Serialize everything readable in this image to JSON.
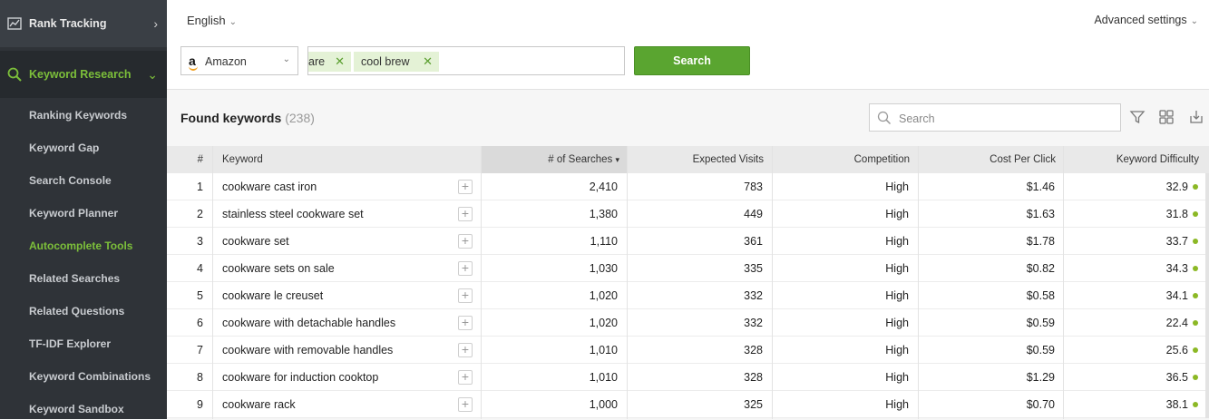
{
  "sidebar": {
    "rank_tracking": "Rank Tracking",
    "keyword_research": "Keyword Research",
    "items": [
      {
        "label": "Ranking Keywords",
        "active": false
      },
      {
        "label": "Keyword Gap",
        "active": false
      },
      {
        "label": "Search Console",
        "active": false
      },
      {
        "label": "Keyword Planner",
        "active": false
      },
      {
        "label": "Autocomplete Tools",
        "active": true
      },
      {
        "label": "Related Searches",
        "active": false
      },
      {
        "label": "Related Questions",
        "active": false
      },
      {
        "label": "TF-IDF Explorer",
        "active": false
      },
      {
        "label": "Keyword Combinations",
        "active": false
      },
      {
        "label": "Keyword Sandbox",
        "active": false
      }
    ]
  },
  "topbar": {
    "language": "English",
    "advanced": "Advanced settings"
  },
  "search_form": {
    "engine": "Amazon",
    "tags": [
      "are",
      "cool brew"
    ],
    "button": "Search"
  },
  "results": {
    "title": "Found keywords",
    "count": "(238)",
    "search_placeholder": "Search",
    "columns": [
      "#",
      "Keyword",
      "# of Searches",
      "Expected Visits",
      "Competition",
      "Cost Per Click",
      "Keyword Difficulty"
    ],
    "sort_indicator": "▾",
    "rows": [
      {
        "num": "1",
        "keyword": "cookware cast iron",
        "searches": "2,410",
        "visits": "783",
        "competition": "High",
        "cpc": "$1.46",
        "difficulty": "32.9"
      },
      {
        "num": "2",
        "keyword": "stainless steel cookware set",
        "searches": "1,380",
        "visits": "449",
        "competition": "High",
        "cpc": "$1.63",
        "difficulty": "31.8"
      },
      {
        "num": "3",
        "keyword": "cookware set",
        "searches": "1,110",
        "visits": "361",
        "competition": "High",
        "cpc": "$1.78",
        "difficulty": "33.7"
      },
      {
        "num": "4",
        "keyword": "cookware sets on sale",
        "searches": "1,030",
        "visits": "335",
        "competition": "High",
        "cpc": "$0.82",
        "difficulty": "34.3"
      },
      {
        "num": "5",
        "keyword": "cookware le creuset",
        "searches": "1,020",
        "visits": "332",
        "competition": "High",
        "cpc": "$0.58",
        "difficulty": "34.1"
      },
      {
        "num": "6",
        "keyword": "cookware with detachable handles",
        "searches": "1,020",
        "visits": "332",
        "competition": "High",
        "cpc": "$0.59",
        "difficulty": "22.4"
      },
      {
        "num": "7",
        "keyword": "cookware with removable handles",
        "searches": "1,010",
        "visits": "328",
        "competition": "High",
        "cpc": "$0.59",
        "difficulty": "25.6"
      },
      {
        "num": "8",
        "keyword": "cookware for induction cooktop",
        "searches": "1,010",
        "visits": "328",
        "competition": "High",
        "cpc": "$1.29",
        "difficulty": "36.5"
      },
      {
        "num": "9",
        "keyword": "cookware rack",
        "searches": "1,000",
        "visits": "325",
        "competition": "High",
        "cpc": "$0.70",
        "difficulty": "38.1"
      }
    ]
  },
  "colors": {
    "accent": "#7cbf3a",
    "button": "#5aa530",
    "sidebar": "#2f3338",
    "difficulty_dot": "#8cb825"
  }
}
